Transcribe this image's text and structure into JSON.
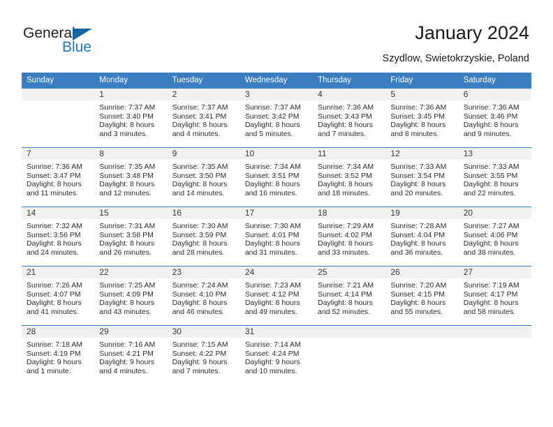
{
  "brand": {
    "name_part1": "General",
    "name_part2": "Blue",
    "triangle_icon": "triangle-icon",
    "accent_color": "#1b76c4"
  },
  "header": {
    "title": "January 2024",
    "subtitle": "Szydlow, Swietokrzyskie, Poland"
  },
  "calendar": {
    "header_bg": "#3a7ebf",
    "daynum_bg": "#f1f1f1",
    "weekday_headers": [
      "Sunday",
      "Monday",
      "Tuesday",
      "Wednesday",
      "Thursday",
      "Friday",
      "Saturday"
    ],
    "weeks": [
      [
        {
          "day": "",
          "sunrise": "",
          "sunset": "",
          "daylight1": "",
          "daylight2": ""
        },
        {
          "day": "1",
          "sunrise": "Sunrise: 7:37 AM",
          "sunset": "Sunset: 3:40 PM",
          "daylight1": "Daylight: 8 hours",
          "daylight2": "and 3 minutes."
        },
        {
          "day": "2",
          "sunrise": "Sunrise: 7:37 AM",
          "sunset": "Sunset: 3:41 PM",
          "daylight1": "Daylight: 8 hours",
          "daylight2": "and 4 minutes."
        },
        {
          "day": "3",
          "sunrise": "Sunrise: 7:37 AM",
          "sunset": "Sunset: 3:42 PM",
          "daylight1": "Daylight: 8 hours",
          "daylight2": "and 5 minutes."
        },
        {
          "day": "4",
          "sunrise": "Sunrise: 7:36 AM",
          "sunset": "Sunset: 3:43 PM",
          "daylight1": "Daylight: 8 hours",
          "daylight2": "and 7 minutes."
        },
        {
          "day": "5",
          "sunrise": "Sunrise: 7:36 AM",
          "sunset": "Sunset: 3:45 PM",
          "daylight1": "Daylight: 8 hours",
          "daylight2": "and 8 minutes."
        },
        {
          "day": "6",
          "sunrise": "Sunrise: 7:36 AM",
          "sunset": "Sunset: 3:46 PM",
          "daylight1": "Daylight: 8 hours",
          "daylight2": "and 9 minutes."
        }
      ],
      [
        {
          "day": "7",
          "sunrise": "Sunrise: 7:36 AM",
          "sunset": "Sunset: 3:47 PM",
          "daylight1": "Daylight: 8 hours",
          "daylight2": "and 11 minutes."
        },
        {
          "day": "8",
          "sunrise": "Sunrise: 7:35 AM",
          "sunset": "Sunset: 3:48 PM",
          "daylight1": "Daylight: 8 hours",
          "daylight2": "and 12 minutes."
        },
        {
          "day": "9",
          "sunrise": "Sunrise: 7:35 AM",
          "sunset": "Sunset: 3:50 PM",
          "daylight1": "Daylight: 8 hours",
          "daylight2": "and 14 minutes."
        },
        {
          "day": "10",
          "sunrise": "Sunrise: 7:34 AM",
          "sunset": "Sunset: 3:51 PM",
          "daylight1": "Daylight: 8 hours",
          "daylight2": "and 16 minutes."
        },
        {
          "day": "11",
          "sunrise": "Sunrise: 7:34 AM",
          "sunset": "Sunset: 3:52 PM",
          "daylight1": "Daylight: 8 hours",
          "daylight2": "and 18 minutes."
        },
        {
          "day": "12",
          "sunrise": "Sunrise: 7:33 AM",
          "sunset": "Sunset: 3:54 PM",
          "daylight1": "Daylight: 8 hours",
          "daylight2": "and 20 minutes."
        },
        {
          "day": "13",
          "sunrise": "Sunrise: 7:33 AM",
          "sunset": "Sunset: 3:55 PM",
          "daylight1": "Daylight: 8 hours",
          "daylight2": "and 22 minutes."
        }
      ],
      [
        {
          "day": "14",
          "sunrise": "Sunrise: 7:32 AM",
          "sunset": "Sunset: 3:56 PM",
          "daylight1": "Daylight: 8 hours",
          "daylight2": "and 24 minutes."
        },
        {
          "day": "15",
          "sunrise": "Sunrise: 7:31 AM",
          "sunset": "Sunset: 3:58 PM",
          "daylight1": "Daylight: 8 hours",
          "daylight2": "and 26 minutes."
        },
        {
          "day": "16",
          "sunrise": "Sunrise: 7:30 AM",
          "sunset": "Sunset: 3:59 PM",
          "daylight1": "Daylight: 8 hours",
          "daylight2": "and 28 minutes."
        },
        {
          "day": "17",
          "sunrise": "Sunrise: 7:30 AM",
          "sunset": "Sunset: 4:01 PM",
          "daylight1": "Daylight: 8 hours",
          "daylight2": "and 31 minutes."
        },
        {
          "day": "18",
          "sunrise": "Sunrise: 7:29 AM",
          "sunset": "Sunset: 4:02 PM",
          "daylight1": "Daylight: 8 hours",
          "daylight2": "and 33 minutes."
        },
        {
          "day": "19",
          "sunrise": "Sunrise: 7:28 AM",
          "sunset": "Sunset: 4:04 PM",
          "daylight1": "Daylight: 8 hours",
          "daylight2": "and 36 minutes."
        },
        {
          "day": "20",
          "sunrise": "Sunrise: 7:27 AM",
          "sunset": "Sunset: 4:06 PM",
          "daylight1": "Daylight: 8 hours",
          "daylight2": "and 38 minutes."
        }
      ],
      [
        {
          "day": "21",
          "sunrise": "Sunrise: 7:26 AM",
          "sunset": "Sunset: 4:07 PM",
          "daylight1": "Daylight: 8 hours",
          "daylight2": "and 41 minutes."
        },
        {
          "day": "22",
          "sunrise": "Sunrise: 7:25 AM",
          "sunset": "Sunset: 4:09 PM",
          "daylight1": "Daylight: 8 hours",
          "daylight2": "and 43 minutes."
        },
        {
          "day": "23",
          "sunrise": "Sunrise: 7:24 AM",
          "sunset": "Sunset: 4:10 PM",
          "daylight1": "Daylight: 8 hours",
          "daylight2": "and 46 minutes."
        },
        {
          "day": "24",
          "sunrise": "Sunrise: 7:23 AM",
          "sunset": "Sunset: 4:12 PM",
          "daylight1": "Daylight: 8 hours",
          "daylight2": "and 49 minutes."
        },
        {
          "day": "25",
          "sunrise": "Sunrise: 7:21 AM",
          "sunset": "Sunset: 4:14 PM",
          "daylight1": "Daylight: 8 hours",
          "daylight2": "and 52 minutes."
        },
        {
          "day": "26",
          "sunrise": "Sunrise: 7:20 AM",
          "sunset": "Sunset: 4:15 PM",
          "daylight1": "Daylight: 8 hours",
          "daylight2": "and 55 minutes."
        },
        {
          "day": "27",
          "sunrise": "Sunrise: 7:19 AM",
          "sunset": "Sunset: 4:17 PM",
          "daylight1": "Daylight: 8 hours",
          "daylight2": "and 58 minutes."
        }
      ],
      [
        {
          "day": "28",
          "sunrise": "Sunrise: 7:18 AM",
          "sunset": "Sunset: 4:19 PM",
          "daylight1": "Daylight: 9 hours",
          "daylight2": "and 1 minute."
        },
        {
          "day": "29",
          "sunrise": "Sunrise: 7:16 AM",
          "sunset": "Sunset: 4:21 PM",
          "daylight1": "Daylight: 9 hours",
          "daylight2": "and 4 minutes."
        },
        {
          "day": "30",
          "sunrise": "Sunrise: 7:15 AM",
          "sunset": "Sunset: 4:22 PM",
          "daylight1": "Daylight: 9 hours",
          "daylight2": "and 7 minutes."
        },
        {
          "day": "31",
          "sunrise": "Sunrise: 7:14 AM",
          "sunset": "Sunset: 4:24 PM",
          "daylight1": "Daylight: 9 hours",
          "daylight2": "and 10 minutes."
        },
        {
          "day": "",
          "sunrise": "",
          "sunset": "",
          "daylight1": "",
          "daylight2": ""
        },
        {
          "day": "",
          "sunrise": "",
          "sunset": "",
          "daylight1": "",
          "daylight2": ""
        },
        {
          "day": "",
          "sunrise": "",
          "sunset": "",
          "daylight1": "",
          "daylight2": ""
        }
      ]
    ]
  }
}
